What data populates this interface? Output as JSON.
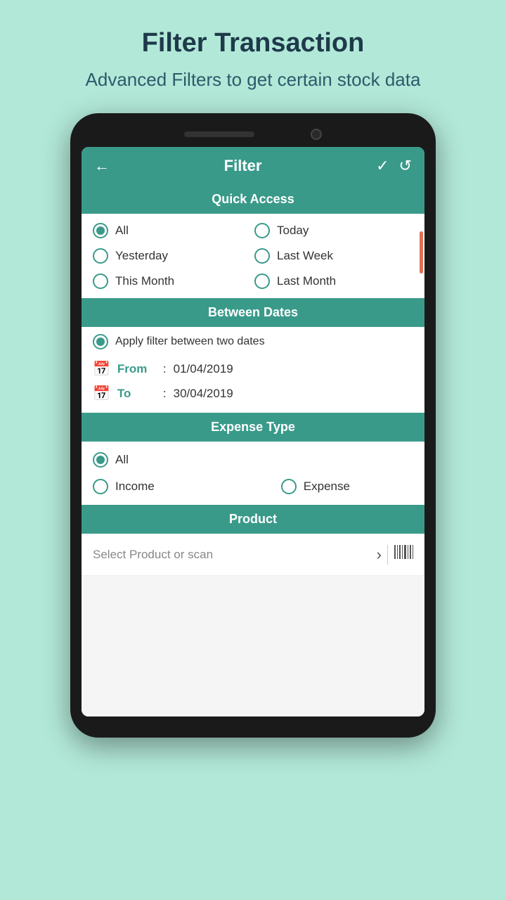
{
  "page": {
    "title": "Filter Transaction",
    "subtitle": "Advanced Filters to get certain stock data"
  },
  "header": {
    "title": "Filter",
    "back_label": "←",
    "check_label": "✓",
    "reset_label": "↺"
  },
  "quick_access": {
    "section_label": "Quick Access",
    "options": [
      {
        "label": "All",
        "checked": true,
        "col": 1
      },
      {
        "label": "Today",
        "checked": false,
        "col": 2
      },
      {
        "label": "Yesterday",
        "checked": false,
        "col": 1
      },
      {
        "label": "Last Week",
        "checked": false,
        "col": 2
      },
      {
        "label": "This Month",
        "checked": false,
        "col": 1
      },
      {
        "label": "Last Month",
        "checked": false,
        "col": 2
      }
    ]
  },
  "between_dates": {
    "section_label": "Between Dates",
    "apply_label": "Apply filter between two dates",
    "from_label": "From",
    "from_value": "01/04/2019",
    "to_label": "To",
    "to_value": "30/04/2019",
    "separator": ":"
  },
  "expense_type": {
    "section_label": "Expense Type",
    "options_top": [
      {
        "label": "All",
        "checked": true
      }
    ],
    "options_bottom": [
      {
        "label": "Income",
        "checked": false,
        "col": 1
      },
      {
        "label": "Expense",
        "checked": false,
        "col": 2
      }
    ]
  },
  "product": {
    "section_label": "Product",
    "placeholder": "Select Product or scan",
    "arrow": "›",
    "barcode": "▦"
  }
}
